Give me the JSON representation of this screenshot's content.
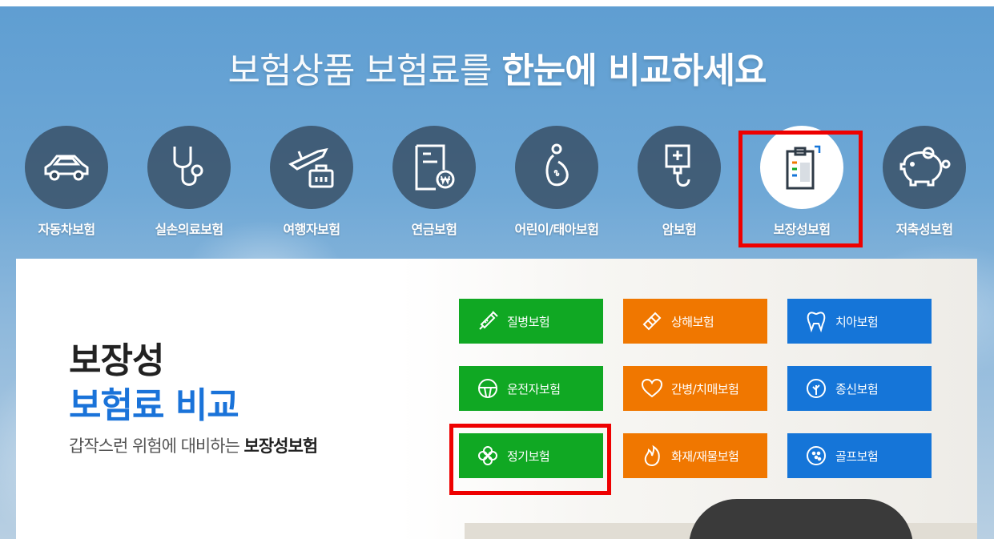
{
  "headline": {
    "light": "보험상품 보험료를",
    "bold": "한눈에 비교하세요"
  },
  "categories": [
    {
      "label": "자동차보험",
      "icon": "car-icon"
    },
    {
      "label": "실손의료보험",
      "icon": "stethoscope-icon"
    },
    {
      "label": "여행자보험",
      "icon": "airplane-luggage-icon"
    },
    {
      "label": "연금보험",
      "icon": "pension-document-icon"
    },
    {
      "label": "어린이/태아보험",
      "icon": "pregnant-icon"
    },
    {
      "label": "암보험",
      "icon": "iv-bag-icon"
    },
    {
      "label": "보장성보험",
      "icon": "clipboard-icon",
      "active": true
    },
    {
      "label": "저축성보험",
      "icon": "piggy-bank-icon"
    }
  ],
  "panel": {
    "title_line1": "보장성",
    "title_line2": "보험료 비교",
    "subtitle_normal": "갑작스런 위험에 대비하는 ",
    "subtitle_bold": "보장성보험"
  },
  "products": [
    {
      "label": "질병보험",
      "icon": "syringe-icon",
      "color": "#10a823"
    },
    {
      "label": "상해보험",
      "icon": "bandage-icon",
      "color": "#f07700"
    },
    {
      "label": "치아보험",
      "icon": "tooth-icon",
      "color": "#1575d8"
    },
    {
      "label": "운전자보험",
      "icon": "steering-wheel-icon",
      "color": "#10a823"
    },
    {
      "label": "간병/치매보험",
      "icon": "heart-icon",
      "color": "#f07700"
    },
    {
      "label": "종신보험",
      "icon": "tree-icon",
      "color": "#1575d8"
    },
    {
      "label": "정기보험",
      "icon": "clover-icon",
      "color": "#10a823"
    },
    {
      "label": "화재/재물보험",
      "icon": "fire-icon",
      "color": "#f07700"
    },
    {
      "label": "골프보험",
      "icon": "golf-ball-icon",
      "color": "#1575d8"
    }
  ],
  "colors": {
    "highlight": "#ee0000",
    "accent_blue": "#1a73d9"
  }
}
